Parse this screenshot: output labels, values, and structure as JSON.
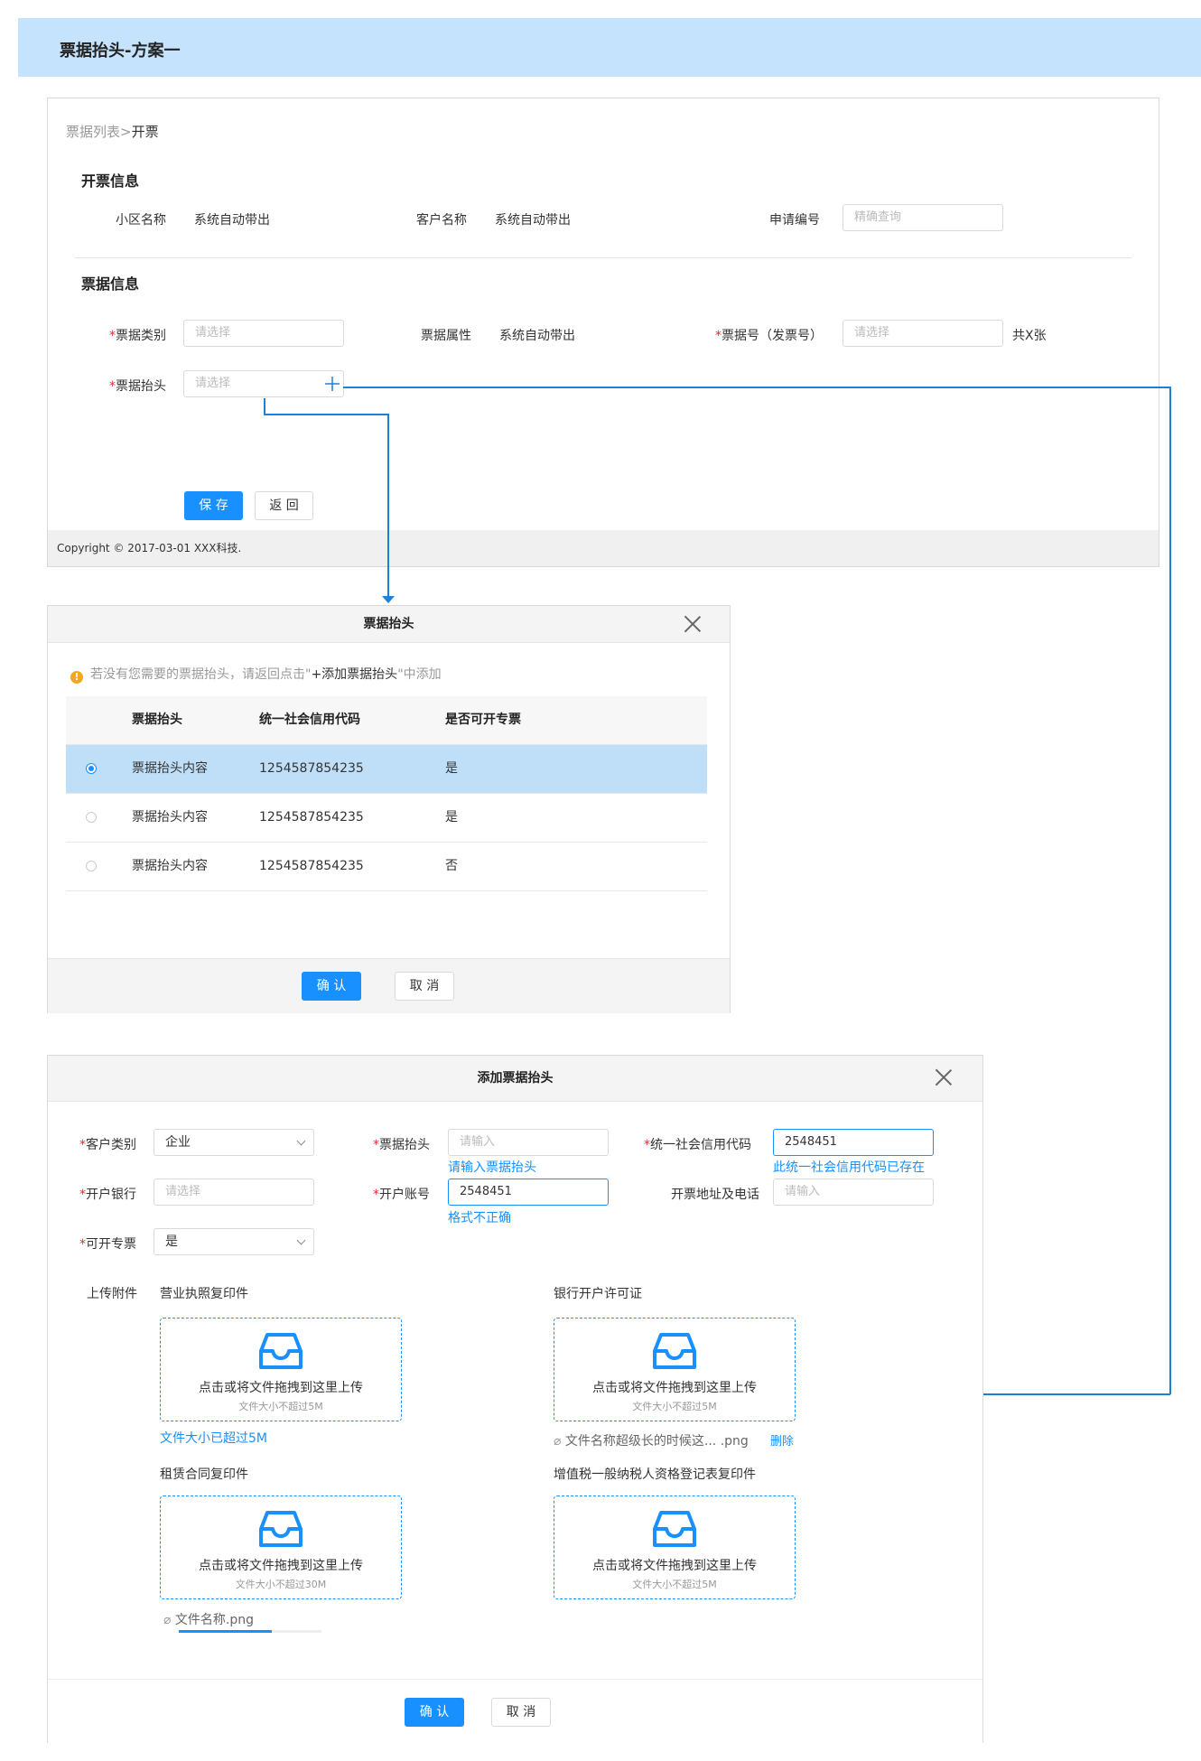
{
  "header": {
    "title": "票据抬头-方案一"
  },
  "page": {
    "breadcrumb_parent": "票据列表",
    "breadcrumb_sep": ">",
    "breadcrumb_current": "开票",
    "section_invoice_info": "开票信息",
    "community_label": "小区名称",
    "community_value": "系统自动带出",
    "customer_label": "客户名称",
    "customer_value": "系统自动带出",
    "apply_no_label": "申请编号",
    "apply_no_placeholder": "精确查询",
    "section_bill_info": "票据信息",
    "req_mark": "*",
    "bill_type_label": "票据类别",
    "bill_type_placeholder": "请选择",
    "bill_attr_label": "票据属性",
    "bill_attr_value": "系统自动带出",
    "bill_no_label": "票据号（发票号）",
    "bill_no_placeholder": "请选择",
    "bill_count": "共X张",
    "bill_title_label": "票据抬头",
    "bill_title_placeholder": "请选择",
    "save_label": "保 存",
    "back_label": "返 回",
    "copyright": "Copyright © 2017-03-01 XXX科技."
  },
  "select_modal": {
    "title": "票据抬头",
    "warn_icon": "!",
    "warn_prefix": "若没有您需要的票据抬头，请返回点击\"",
    "warn_action": "+添加票据抬头",
    "warn_suffix": "\"中添加",
    "columns": [
      "票据抬头",
      "统一社会信用代码",
      "是否可开专票"
    ],
    "rows": [
      {
        "title": "票据抬头内容",
        "code": "1254587854235",
        "special": "是",
        "selected": true
      },
      {
        "title": "票据抬头内容",
        "code": "1254587854235",
        "special": "是",
        "selected": false
      },
      {
        "title": "票据抬头内容",
        "code": "1254587854235",
        "special": "否",
        "selected": false
      }
    ],
    "confirm_label": "确 认",
    "cancel_label": "取 消"
  },
  "add_modal": {
    "title": "添加票据抬头",
    "req_mark": "*",
    "customer_type_label": "客户类别",
    "customer_type_value": "企业",
    "bill_title_label": "票据抬头",
    "bill_title_placeholder": "请输入",
    "bill_title_error": "请输入票据抬头",
    "credit_code_label": "统一社会信用代码",
    "credit_code_value": "2548451",
    "credit_code_error": "此统一社会信用代码已存在",
    "bank_label": "开户银行",
    "bank_placeholder": "请选择",
    "account_label": "开户账号",
    "account_value": "2548451",
    "account_error": "格式不正确",
    "address_label": "开票地址及电话",
    "address_placeholder": "请输入",
    "special_label": "可开专票",
    "special_value": "是",
    "upload_label": "上传附件",
    "upload_hint": "点击或将文件拖拽到这里上传",
    "uploads": [
      {
        "title": "营业执照复印件",
        "limit": "文件大小不超过5M",
        "error": "文件大小已超过5M"
      },
      {
        "title": "银行开户许可证",
        "limit": "文件大小不超过5M",
        "file": "文件名称超级长的时候这... .png",
        "delete": "删除"
      },
      {
        "title": "租赁合同复印件",
        "limit": "文件大小不超过30M",
        "file": "文件名称.png",
        "progress": 0.65
      },
      {
        "title": "增值税一般纳税人资格登记表复印件",
        "limit": "文件大小不超过5M"
      }
    ],
    "confirm_label": "确 认",
    "cancel_label": "取 消"
  },
  "colors": {
    "primary": "#1890ff",
    "header_bg": "#c6e3fd",
    "selected_row": "#bfdff9",
    "connector": "#1e7fd6"
  }
}
